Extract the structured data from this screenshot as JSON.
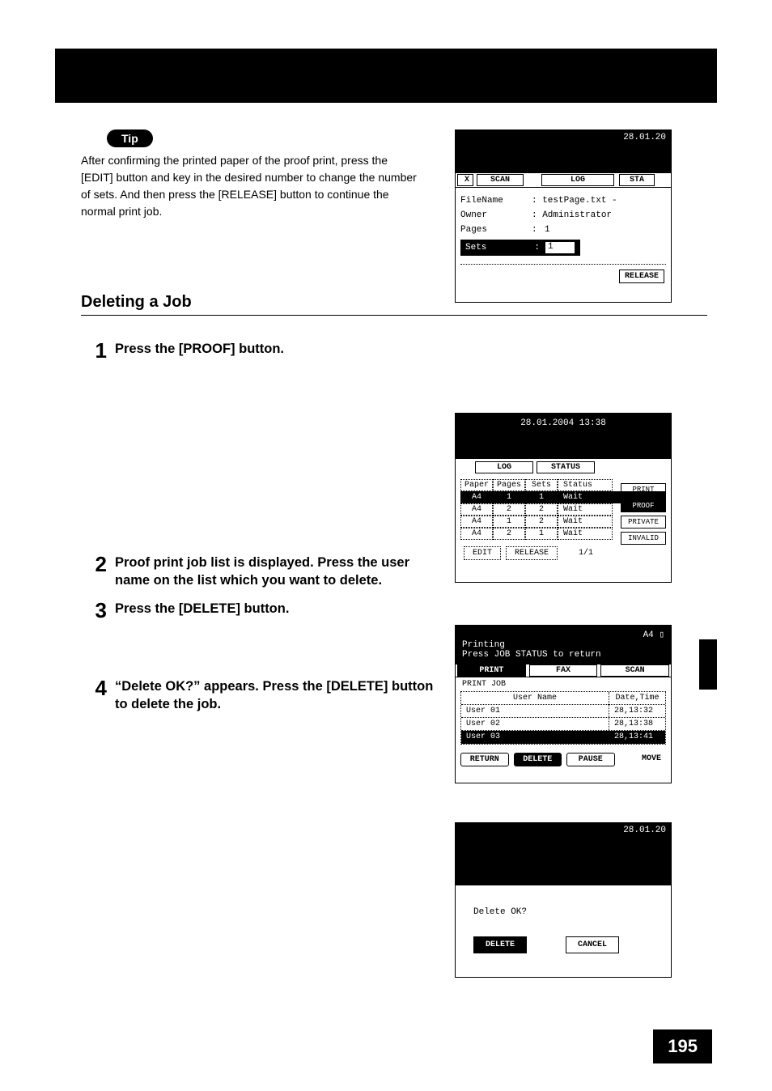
{
  "tip": {
    "badge": "Tip",
    "text": "After confirming the printed paper of the proof print, press the [EDIT] button and key in the desired number to change the number of sets. And then press the [RELEASE] button to continue the normal print job."
  },
  "section_title": "Deleting a Job",
  "steps": {
    "s1": "Press the [PROOF] button.",
    "s2": "Proof print job list is displayed. Press the user name on the list which you want to delete.",
    "s3": "Press the [DELETE] button.",
    "s4": "“Delete OK?” appears. Press the [DELETE] button to delete the job."
  },
  "fig1": {
    "date": "28.01.20",
    "tabs": {
      "x": "X",
      "scan": "SCAN",
      "log": "LOG",
      "sta": "STA"
    },
    "rows": {
      "filename_lab": "FileName",
      "filename_val": ": testPage.txt -",
      "owner_lab": "Owner",
      "owner_val": ": Administrator",
      "pages_lab": "Pages",
      "pages_col": ":",
      "pages_val": "1",
      "sets_lab": "Sets",
      "sets_col": ":",
      "sets_val": "1"
    },
    "release": "RELEASE"
  },
  "fig2": {
    "datetime": "28.01.2004 13:38",
    "tabs": {
      "log": "LOG",
      "status": "STATUS"
    },
    "headers": {
      "paper": "Paper",
      "pages": "Pages",
      "sets": "Sets",
      "status": "Status"
    },
    "rows": [
      {
        "paper": "A4",
        "pages": "1",
        "sets": "1",
        "status": "Wait"
      },
      {
        "paper": "A4",
        "pages": "2",
        "sets": "2",
        "status": "Wait"
      },
      {
        "paper": "A4",
        "pages": "1",
        "sets": "2",
        "status": "Wait"
      },
      {
        "paper": "A4",
        "pages": "2",
        "sets": "1",
        "status": "Wait"
      }
    ],
    "side": {
      "print": "PRINT",
      "proof": "PROOF",
      "private": "PRIVATE",
      "invalid": "INVALID"
    },
    "bottom": {
      "edit": "EDIT",
      "release": "RELEASE",
      "page": "1/1"
    }
  },
  "fig3": {
    "a4": "A4",
    "line1": "Printing",
    "line2": "Press JOB STATUS to return",
    "tabs": {
      "print": "PRINT",
      "fax": "FAX",
      "scan": "SCAN"
    },
    "sub": "PRINT JOB",
    "headers": {
      "user": "User Name",
      "dt": "Date,Time"
    },
    "rows": [
      {
        "user": "User 01",
        "dt": "28,13:32"
      },
      {
        "user": "User 02",
        "dt": "28,13:38"
      },
      {
        "user": "User 03",
        "dt": "28,13:41"
      }
    ],
    "btns": {
      "return": "RETURN",
      "delete": "DELETE",
      "pause": "PAUSE",
      "move": "MOVE"
    }
  },
  "fig4": {
    "date": "28.01.20",
    "q": "Delete OK?",
    "delete": "DELETE",
    "cancel": "CANCEL"
  },
  "page_number": "195",
  "chart_data": {
    "type": "table",
    "description": "Proof print job list shown on device LCD",
    "headers": [
      "Paper",
      "Pages",
      "Sets",
      "Status"
    ],
    "rows": [
      [
        "A4",
        1,
        1,
        "Wait"
      ],
      [
        "A4",
        2,
        2,
        "Wait"
      ],
      [
        "A4",
        1,
        2,
        "Wait"
      ],
      [
        "A4",
        2,
        1,
        "Wait"
      ]
    ]
  }
}
